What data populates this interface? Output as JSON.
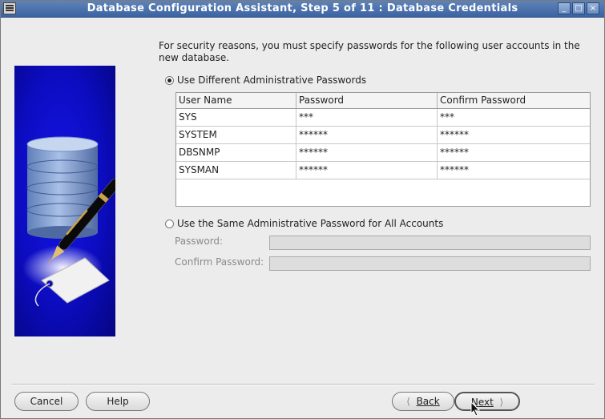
{
  "window": {
    "title": "Database Configuration Assistant, Step 5 of 11 : Database Credentials",
    "controls": [
      "_",
      "□",
      "×"
    ]
  },
  "intro_text": "For security reasons, you must specify passwords for the following user accounts in the new database.",
  "options": {
    "different": {
      "label": "Use Different Administrative Passwords",
      "selected": true
    },
    "same": {
      "label": "Use the Same Administrative Password for All Accounts",
      "selected": false
    }
  },
  "table": {
    "headers": [
      "User Name",
      "Password",
      "Confirm Password"
    ],
    "rows": [
      {
        "user": "SYS",
        "password": "***",
        "confirm": "***"
      },
      {
        "user": "SYSTEM",
        "password": "******",
        "confirm": "******"
      },
      {
        "user": "DBSNMP",
        "password": "******",
        "confirm": "******"
      },
      {
        "user": "SYSMAN",
        "password": "******",
        "confirm": "******"
      }
    ]
  },
  "same_password": {
    "password_label": "Password:",
    "confirm_label": "Confirm Password:",
    "password_value": "",
    "confirm_value": ""
  },
  "buttons": {
    "cancel": "Cancel",
    "help": "Help",
    "back": "Back",
    "next": "Next"
  },
  "colors": {
    "titlebar": "#4a70ac",
    "panel": "#0c0cc0"
  }
}
